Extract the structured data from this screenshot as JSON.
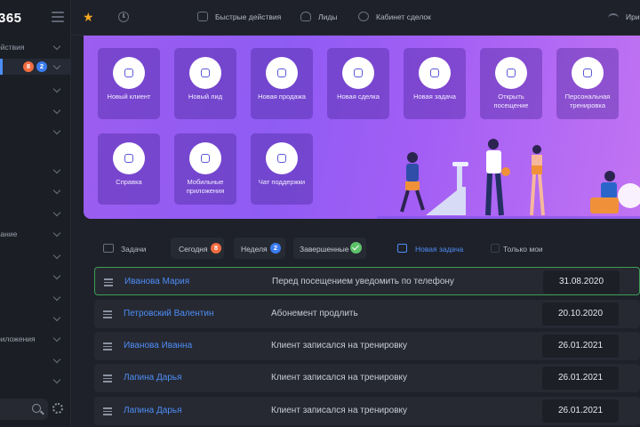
{
  "app": {
    "logo": "365"
  },
  "sidebar": {
    "items": [
      {
        "label": "ействия"
      },
      {
        "label": ""
      },
      {
        "label": ""
      },
      {
        "label": ""
      },
      {
        "label": ""
      },
      {
        "label": ""
      },
      {
        "label": ""
      },
      {
        "label": "вание"
      },
      {
        "label": ""
      },
      {
        "label": ""
      },
      {
        "label": ""
      },
      {
        "label": "риложения"
      },
      {
        "label": ""
      }
    ],
    "badges": {
      "orange": "8",
      "blue": "2"
    }
  },
  "topbar": {
    "quick_actions": "Быстрые действия",
    "leads": "Лиды",
    "deals": "Кабинет сделок",
    "user": "Ири"
  },
  "tiles": [
    {
      "label": "Новый клиент"
    },
    {
      "label": "Новый лид"
    },
    {
      "label": "Новая продажа"
    },
    {
      "label": "Новая сделка"
    },
    {
      "label": "Новая задача"
    },
    {
      "label": "Открыть посещение"
    },
    {
      "label": "Персональная тренировка"
    },
    {
      "label": "Справка"
    },
    {
      "label": "Мобильные приложения"
    },
    {
      "label": "Чат поддержки"
    }
  ],
  "tasks": {
    "title": "Задачи",
    "filters": {
      "today": "Сегодня",
      "today_count": "8",
      "week": "Неделя",
      "week_count": "2",
      "done": "Завершенные"
    },
    "new_task": "Новая задача",
    "only_mine": "Только мои",
    "rows": [
      {
        "name": "Иванова Мария",
        "desc": "Перед посещением уведомить по телефону",
        "date": "31.08.2020"
      },
      {
        "name": "Петровский Валентин",
        "desc": "Абонемент продлить",
        "date": "20.10.2020"
      },
      {
        "name": "Иванова Иванна",
        "desc": "Клиент записался на тренировку",
        "date": "26.01.2021"
      },
      {
        "name": "Лапина Дарья",
        "desc": "Клиент записался на тренировку",
        "date": "26.01.2021"
      },
      {
        "name": "Лапина Дарья",
        "desc": "Клиент записался на тренировку",
        "date": "26.01.2021"
      }
    ]
  },
  "colors": {
    "accent": "#4e8df6",
    "hero_start": "#9c5df0",
    "hero_end": "#c173f2",
    "badge_orange": "#f26c3f",
    "success": "#5ec26a"
  }
}
